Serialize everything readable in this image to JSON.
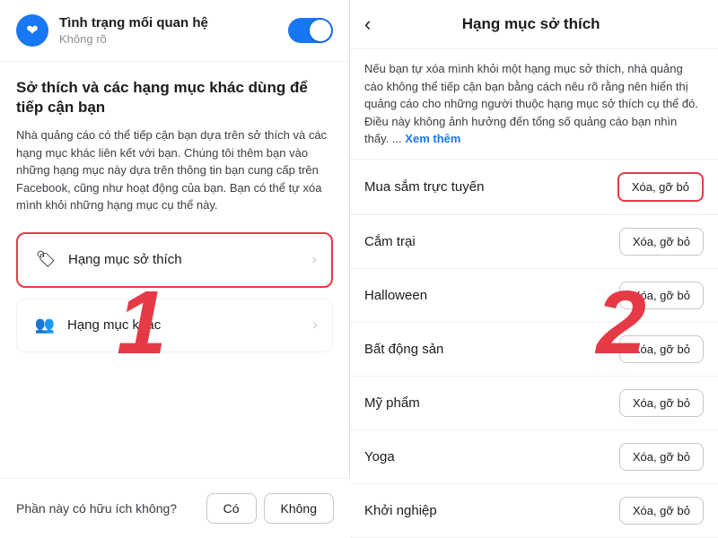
{
  "left": {
    "relationship": {
      "title": "Tình trạng mối quan hệ",
      "subtitle": "Không rõ",
      "toggle_state": true
    },
    "section_title": "Sở thích và các hạng mục khác dùng để tiếp cận bạn",
    "section_desc": "Nhà quảng cáo có thể tiếp cận bạn dựa trên sở thích và các hạng mục khác liên kết với bạn. Chúng tôi thêm bạn vào những hạng mục này dựa trên thông tin bạn cung cấp trên Facebook, cũng như hoạt động của bạn. Bạn có thể tự xóa mình khỏi những hạng mục cụ thể này.",
    "menu_items": [
      {
        "label": "Hạng mục sở thích",
        "icon": "🏷",
        "highlighted": true
      },
      {
        "label": "Hạng mục khác",
        "icon": "👥",
        "highlighted": false
      }
    ],
    "feedback": {
      "question": "Phần này có hữu ích không?",
      "yes_label": "Có",
      "no_label": "Không"
    },
    "number_label": "1"
  },
  "right": {
    "back_icon": "‹",
    "title": "Hạng mục sở thích",
    "description": "Nếu bạn tự xóa mình khỏi một hạng mục sở thích, nhà quảng cáo không thể tiếp cận bạn bằng cách nêu rõ rằng nên hiển thị quảng cáo cho những người thuộc hạng mục sở thích cụ thể đó. Điều này không ảnh hưởng đến tổng số quảng cáo bạn nhìn thấy. ...",
    "see_more_label": "Xem thêm",
    "interests": [
      {
        "name": "Mua sắm trực tuyến",
        "btn": "Xóa, gỡ bỏ",
        "highlighted": true
      },
      {
        "name": "Cắm trại",
        "btn": "Xóa, gỡ bỏ",
        "highlighted": false
      },
      {
        "name": "Halloween",
        "btn": "Xóa, gỡ bỏ",
        "highlighted": false
      },
      {
        "name": "Bất động sản",
        "btn": "Xóa, gỡ bỏ",
        "highlighted": false
      },
      {
        "name": "Mỹ phẩm",
        "btn": "Xóa, gỡ bỏ",
        "highlighted": false
      },
      {
        "name": "Yoga",
        "btn": "Xóa, gỡ bỏ",
        "highlighted": false
      },
      {
        "name": "Khởi nghiệp",
        "btn": "Xóa, gỡ bỏ",
        "highlighted": false
      }
    ],
    "number_label": "2"
  }
}
